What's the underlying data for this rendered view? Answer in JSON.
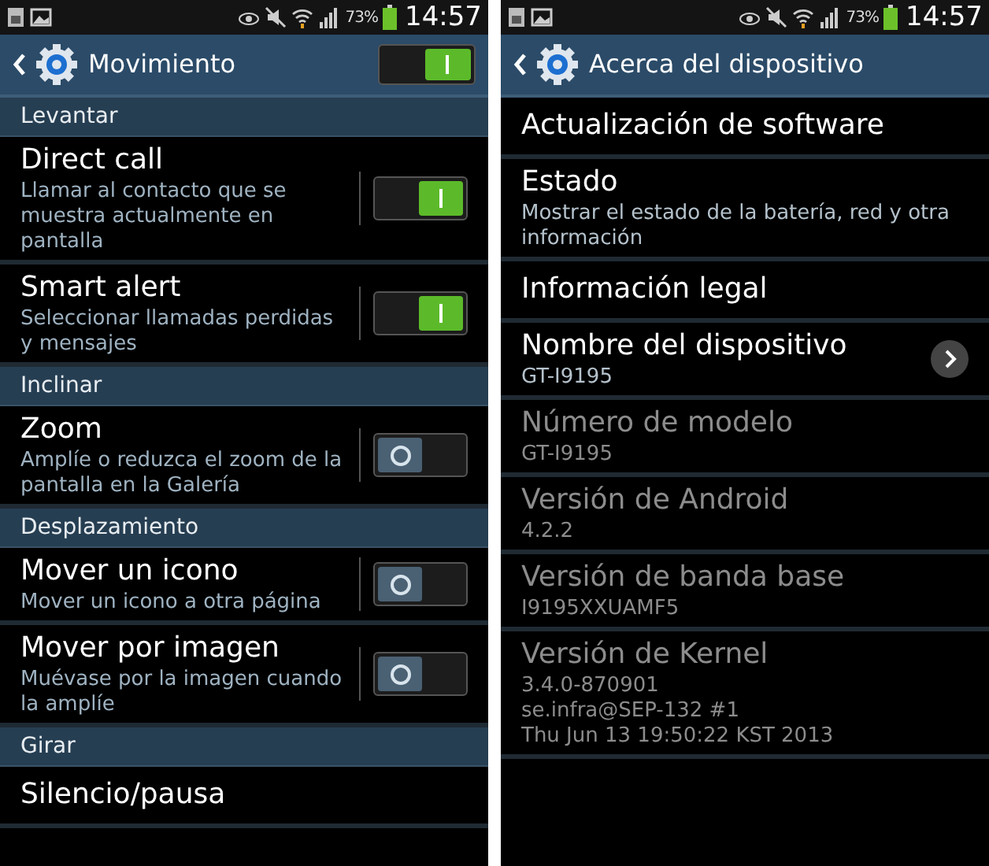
{
  "screens": [
    {
      "status_bar": {
        "battery": "73%",
        "time": "14:57"
      },
      "header": {
        "title": "Movimiento",
        "switch": {
          "on": true
        }
      },
      "items": [
        {
          "kind": "section",
          "title": "Levantar"
        },
        {
          "kind": "toggle",
          "title": "Direct call",
          "summary": "Llamar al contacto que se muestra actualmente en pantalla",
          "on": true
        },
        {
          "kind": "toggle",
          "title": "Smart alert",
          "summary": "Seleccionar llamadas perdidas y mensajes",
          "on": true
        },
        {
          "kind": "section",
          "title": "Inclinar"
        },
        {
          "kind": "toggle",
          "title": "Zoom",
          "summary": "Amplíe o reduzca el zoom de la pantalla en la Galería",
          "on": false
        },
        {
          "kind": "section",
          "title": "Desplazamiento"
        },
        {
          "kind": "toggle",
          "title": "Mover un icono",
          "summary": "Mover un icono a otra página",
          "on": false
        },
        {
          "kind": "toggle",
          "title": "Mover por imagen",
          "summary": "Muévase por la imagen cuando la amplíe",
          "on": false
        },
        {
          "kind": "section",
          "title": "Girar"
        },
        {
          "kind": "plain",
          "title": "Silencio/pausa",
          "disabled": false
        }
      ]
    },
    {
      "status_bar": {
        "battery": "73%",
        "time": "14:57"
      },
      "header": {
        "title": "Acerca del dispositivo"
      },
      "items": [
        {
          "kind": "plain",
          "title": "Actualización de software",
          "disabled": false
        },
        {
          "kind": "plain",
          "title": "Estado",
          "summary": "Mostrar el estado de la batería, red y otra información",
          "disabled": false
        },
        {
          "kind": "plain",
          "title": "Información legal",
          "disabled": false
        },
        {
          "kind": "arrow",
          "title": "Nombre del dispositivo",
          "summary": "GT-I9195",
          "disabled": false
        },
        {
          "kind": "plain",
          "title": "Número de modelo",
          "summary": "GT-I9195",
          "disabled": true
        },
        {
          "kind": "plain",
          "title": "Versión de Android",
          "summary": "4.2.2",
          "disabled": true
        },
        {
          "kind": "plain",
          "title": "Versión de banda base",
          "summary": "I9195XXUAMF5",
          "disabled": true
        },
        {
          "kind": "plain",
          "title": "Versión de Kernel",
          "summary": "3.4.0-870901\nse.infra@SEP-132 #1\nThu Jun 13 19:50:22 KST 2013",
          "disabled": true
        }
      ]
    }
  ]
}
